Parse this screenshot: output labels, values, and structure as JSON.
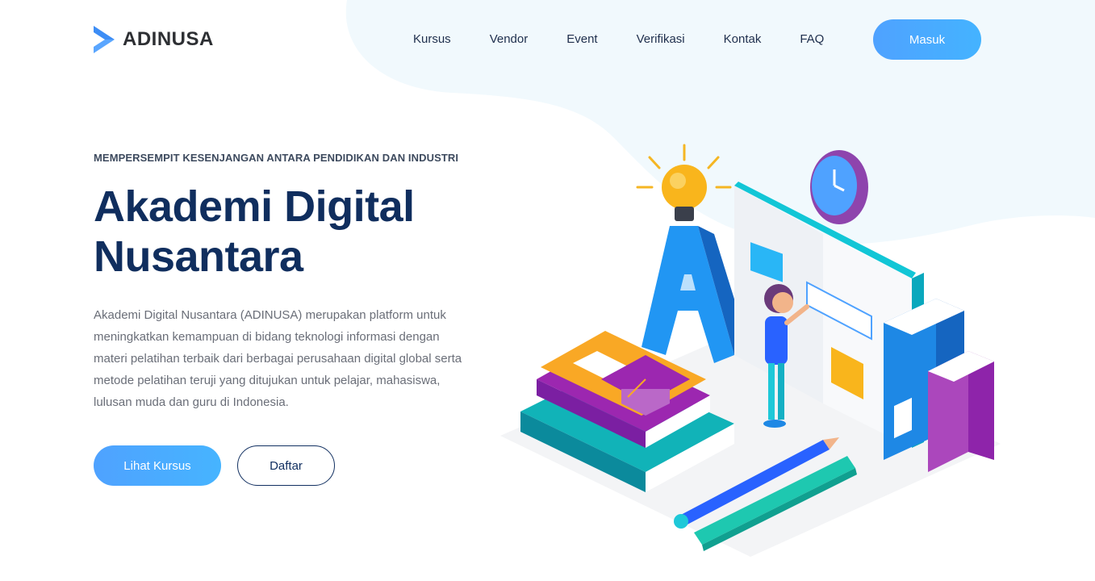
{
  "brand": {
    "name": "ADINUSA",
    "logo_icon": "arrow-logo-icon",
    "accent": "#4fa2ff"
  },
  "nav": {
    "links": [
      "Kursus",
      "Vendor",
      "Event",
      "Verifikasi",
      "Kontak",
      "FAQ"
    ],
    "login_label": "Masuk"
  },
  "hero": {
    "eyebrow": "MEMPERSEMPIT KESENJANGAN ANTARA PENDIDIKAN DAN INDUSTRI",
    "title_line1": "Akademi Digital",
    "title_line2": "Nusantara",
    "description": "Akademi Digital Nusantara (ADINUSA) merupakan platform untuk meningkatkan kemampuan di bidang teknologi informasi dengan materi pelatihan terbaik dari berbagai perusahaan digital global serta metode pelatihan teruji yang ditujukan untuk pelajar, mahasiswa, lulusan muda dan guru di Indonesia.",
    "primary_button": "Lihat Kursus",
    "secondary_button": "Daftar"
  },
  "colors": {
    "title": "#102e5e",
    "blob": "#f1f9fd",
    "button_gradient_start": "#4fa2ff"
  }
}
